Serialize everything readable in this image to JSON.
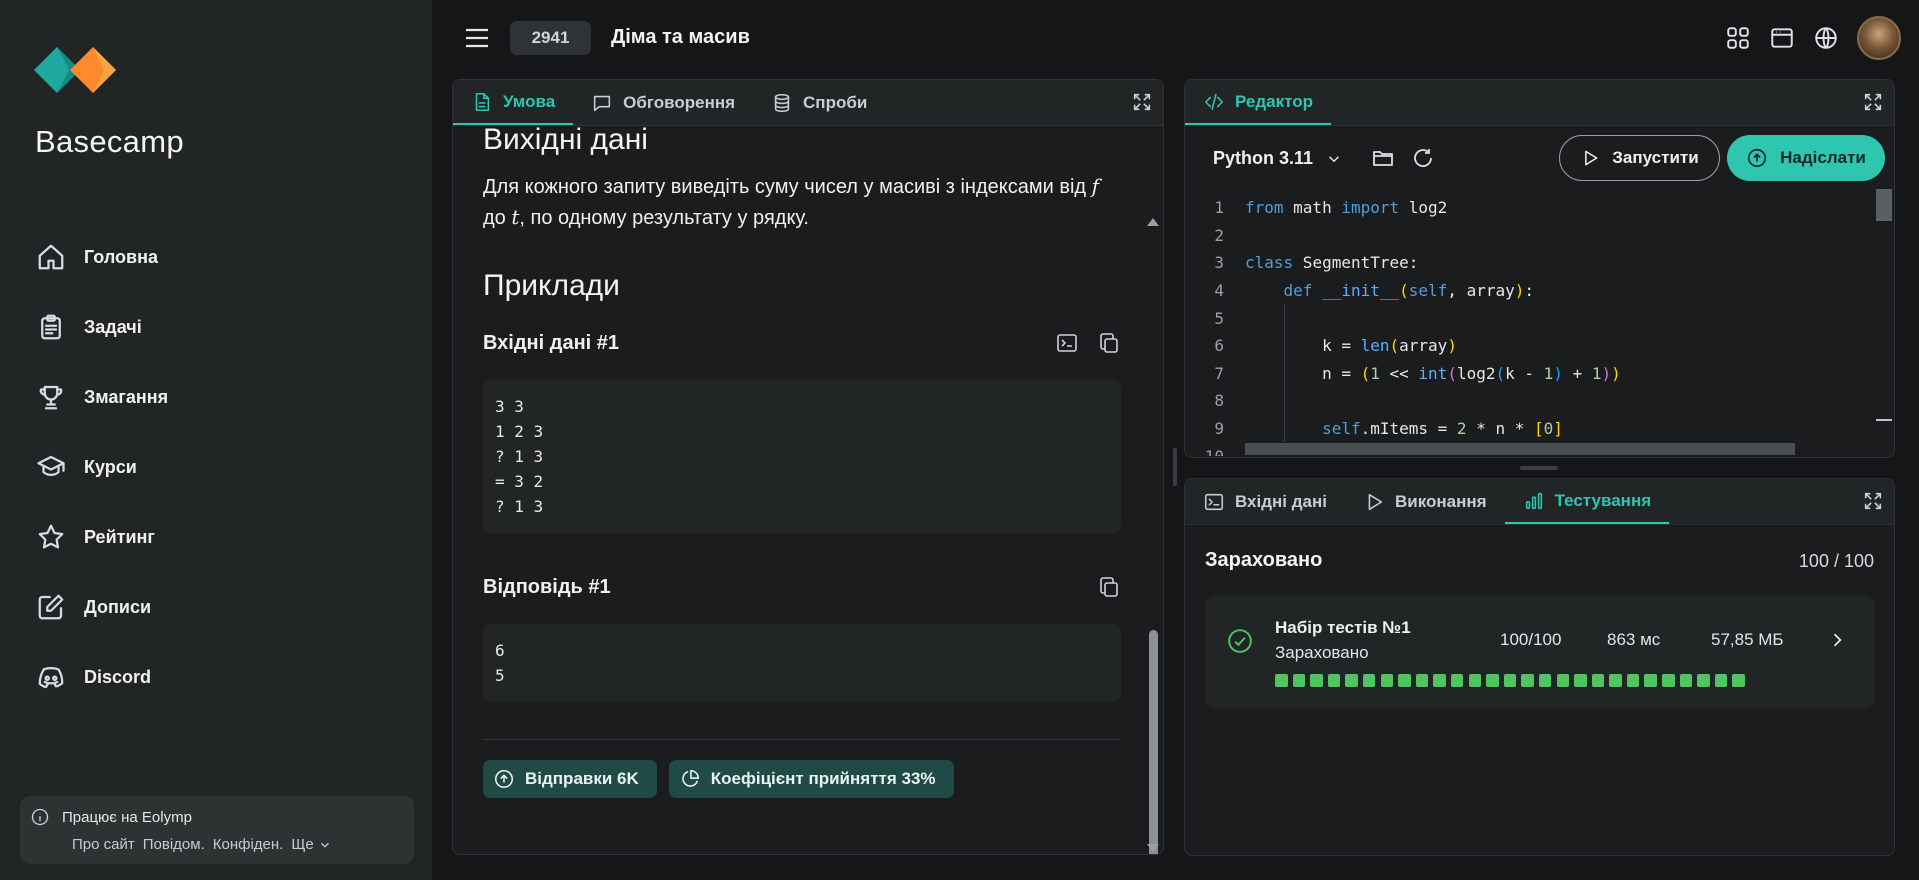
{
  "sidebar": {
    "brand": "Basecamp",
    "items": [
      {
        "label": "Головна",
        "icon": "home-icon"
      },
      {
        "label": "Задачі",
        "icon": "clipboard-icon"
      },
      {
        "label": "Змагання",
        "icon": "trophy-icon"
      },
      {
        "label": "Курси",
        "icon": "graduation-cap-icon"
      },
      {
        "label": "Рейтинг",
        "icon": "star-icon"
      },
      {
        "label": "Дописи",
        "icon": "edit-icon"
      },
      {
        "label": "Discord",
        "icon": "discord-icon"
      }
    ],
    "footer": {
      "powered": "Працює на Eolymp",
      "links": [
        "Про сайт",
        "Повідом.",
        "Конфіден.",
        "Ще"
      ]
    }
  },
  "header": {
    "problem_id": "2941",
    "problem_title": "Діма та масив"
  },
  "statement": {
    "tabs": [
      {
        "label": "Умова",
        "active": true
      },
      {
        "label": "Обговорення",
        "active": false
      },
      {
        "label": "Спроби",
        "active": false
      }
    ],
    "output_heading": "Вихідні дані",
    "output_text_before": "Для кожного запиту виведіть суму чисел у масиві з індексами від ",
    "var_f": "f",
    "output_text_middle": " до ",
    "var_t": "t",
    "output_text_after": ", по одному результату у рядку.",
    "examples_heading": "Приклади",
    "input_label": "Вхідні дані #1",
    "input_value": "3 3\n1 2 3\n? 1 3\n= 3 2\n? 1 3",
    "answer_label": "Відповідь #1",
    "answer_value": "6\n5",
    "submissions_chip": "Відправки 6K",
    "acceptance_chip": "Коефіцієнт прийняття 33%"
  },
  "editor": {
    "tab": "Редактор",
    "language": "Python 3.11",
    "run_label": "Запустити",
    "submit_label": "Надіслати",
    "line_numbers": [
      "1",
      "2",
      "3",
      "4",
      "5",
      "6",
      "7",
      "8",
      "9",
      "10"
    ],
    "code_lines": [
      "from math import log2",
      "",
      "class SegmentTree:",
      "    def __init__(self, array):",
      "",
      "        k = len(array)",
      "        n = (1 << int(log2(k - 1) + 1))",
      "",
      "        self.mItems = 2 * n * [0]",
      ""
    ]
  },
  "results": {
    "tabs": [
      {
        "label": "Вхідні дані",
        "active": false
      },
      {
        "label": "Виконання",
        "active": false
      },
      {
        "label": "Тестування",
        "active": true
      }
    ],
    "verdict": "Зараховано",
    "score": "100 / 100",
    "test_set": {
      "name": "Набір тестів №1",
      "status": "Зараховано",
      "score": "100/100",
      "time": "863 мс",
      "memory": "57,85 МБ",
      "passed_tests": 27,
      "total_tests": 27
    },
    "colors": {
      "accent": "#2fc6b0",
      "pass": "#4fc55f"
    }
  }
}
